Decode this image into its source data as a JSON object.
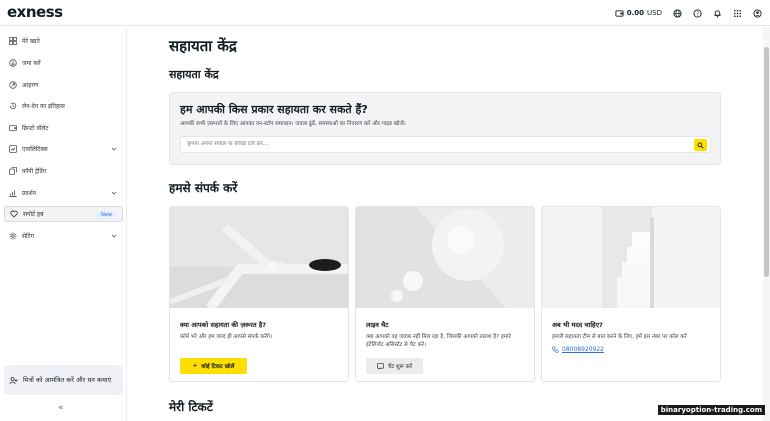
{
  "header": {
    "logo": "exness",
    "balance": "0.00",
    "currency": "USD"
  },
  "sidebar": {
    "items": [
      {
        "label": "मेरे खाते",
        "icon": "grid-icon"
      },
      {
        "label": "जमा करें",
        "icon": "deposit-icon"
      },
      {
        "label": "आहरण",
        "icon": "withdraw-icon"
      },
      {
        "label": "लेन-देन का इतिहास",
        "icon": "history-icon"
      },
      {
        "label": "क्रिप्टो वॉलेट",
        "icon": "wallet-icon"
      },
      {
        "label": "एनालिटिक्स",
        "icon": "analytics-icon"
      },
      {
        "label": "कॉपी ट्रेडिंग",
        "icon": "copy-trading-icon"
      },
      {
        "label": "प्रदर्शन",
        "icon": "performance-icon"
      },
      {
        "label": "सपोर्ट हब",
        "icon": "heart-icon",
        "badge": "New"
      },
      {
        "label": "सेटिंग",
        "icon": "gear-icon"
      }
    ],
    "invite": "मित्रों को आमंत्रित करें और धन कमाएं",
    "collapse": "«"
  },
  "main": {
    "title": "सहायता केंद्र",
    "subtitle": "सहायता केंद्र",
    "help": {
      "title": "हम आपकी किस प्रकार सहायता कर सकते हैं?",
      "description": "आपकी सभी ज़रूरतों के लिए आपका वन-स्टॉप समाधान। जवाब ढूंढें, समस्याओं का निवारण करें और गाइड खोजें।",
      "placeholder": "कृपया अपना सवाल या कीवर्ड दर्ज करें..."
    },
    "contact_title": "हमसे संपर्क करें",
    "cards": [
      {
        "title": "क्या आपको सहायता की ज़रूरत है?",
        "text": "फ़ॉर्म भरें और हम जल्द ही आपसे संपर्क करेंगे।",
        "button": "कोई टिकट खोलें"
      },
      {
        "title": "लाइव चैट",
        "text": "क्या आपको वह जवाब नहीं मिल रहा है, जिसकी आपको तलाश है? हमारे इंटेलिजेंट असिस्टेंट से चैट करें।",
        "button": "चैट शुरू करें"
      },
      {
        "title": "अब भी मदद चाहिए?",
        "text": "हमारी सहायता टीम से बात करने के लिए, हमें इस नंबर पर कॉल करें",
        "phone": "08008920922"
      }
    ],
    "tickets_title": "मेरी टिकटें"
  },
  "watermark": "binaryoption-trading.com"
}
